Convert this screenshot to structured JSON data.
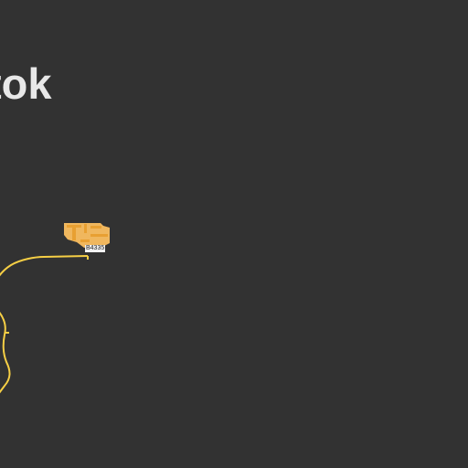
{
  "map": {
    "place_label": "tok",
    "road_badge": "B4335",
    "colors": {
      "background": "#323232",
      "road": "#f6cf45",
      "building": "#f0b75e",
      "building_detail": "#e8a032",
      "label": "#e8e8e8"
    }
  }
}
